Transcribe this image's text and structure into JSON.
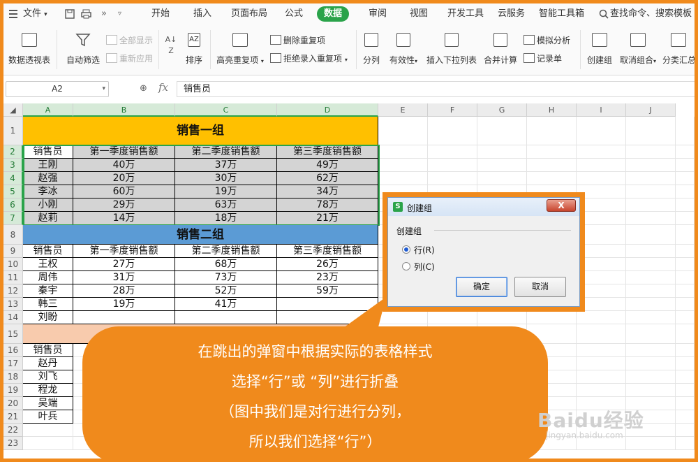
{
  "menu": {
    "file": "文件",
    "tabs": [
      "开始",
      "插入",
      "页面布局",
      "公式",
      "数据",
      "审阅",
      "视图",
      "开发工具",
      "云服务",
      "智能工具箱"
    ],
    "active_tab": "数据",
    "search": "查找命令、搜索模板"
  },
  "toolbar": {
    "pivot": "数据透视表",
    "autofilter": "自动筛选",
    "show_all": "全部显示",
    "reapply": "重新应用",
    "sort": "排序",
    "highlight_dup": "高亮重复项",
    "delete_dup": "删除重复项",
    "reject_dup": "拒绝录入重复项",
    "split": "分列",
    "validity": "有效性",
    "insert_dropdown": "插入下拉列表",
    "consolidate": "合并计算",
    "simulate": "模拟分析",
    "record": "记录单",
    "create_group": "创建组",
    "ungroup": "取消组合",
    "subtotal": "分类汇总"
  },
  "formula_bar": {
    "name_box": "A2",
    "fx": "fx",
    "content": "销售员"
  },
  "columns": [
    "A",
    "B",
    "C",
    "D",
    "E",
    "F",
    "G",
    "H",
    "I",
    "J"
  ],
  "rows": [
    "1",
    "2",
    "3",
    "4",
    "5",
    "6",
    "7",
    "8",
    "9",
    "10",
    "11",
    "12",
    "13",
    "14",
    "15",
    "16",
    "17",
    "18",
    "19",
    "20",
    "21",
    "22",
    "23"
  ],
  "sheet": {
    "group1_title": "销售一组",
    "group2_title": "销售二组",
    "headers": [
      "销售员",
      "第一季度销售额",
      "第二季度销售额",
      "第三季度销售额"
    ],
    "group1_rows": [
      [
        "王刚",
        "40万",
        "37万",
        "49万"
      ],
      [
        "赵强",
        "20万",
        "30万",
        "62万"
      ],
      [
        "李冰",
        "60万",
        "19万",
        "34万"
      ],
      [
        "小刚",
        "29万",
        "63万",
        "78万"
      ],
      [
        "赵莉",
        "14万",
        "18万",
        "21万"
      ]
    ],
    "group2_rows": [
      [
        "王权",
        "27万",
        "68万",
        "26万"
      ],
      [
        "周伟",
        "31万",
        "73万",
        "23万"
      ],
      [
        "秦宇",
        "28万",
        "52万",
        "59万"
      ],
      [
        "韩三",
        "19万",
        "41万",
        ""
      ],
      [
        "刘盼",
        "",
        "",
        ""
      ]
    ],
    "group3_header": "销售员",
    "group3_names": [
      "赵丹",
      "刘飞",
      "程龙",
      "吴端",
      "叶兵"
    ]
  },
  "dialog": {
    "title": "创建组",
    "close": "X",
    "group_label": "创建组",
    "option_row": "行(R)",
    "option_col": "列(C)",
    "selected": "row",
    "ok": "确定",
    "cancel": "取消"
  },
  "callout": {
    "lines": [
      "在跳出的弹窗中根据实际的表格样式",
      "选择“行”或 “列”进行折叠",
      "（图中我们是对行进行分列，",
      "所以我们选择“行”）"
    ]
  },
  "watermark": {
    "main": "Baidu经验",
    "sub": "jingyan.baidu.com"
  },
  "colors": {
    "accent_green": "#2aa34a",
    "group1_fill": "#ffc000",
    "group2_fill": "#5b9bd5",
    "group3_fill": "#f8cbad",
    "selection_fill": "#d4d4d4",
    "callout_orange": "#f08a1c"
  }
}
